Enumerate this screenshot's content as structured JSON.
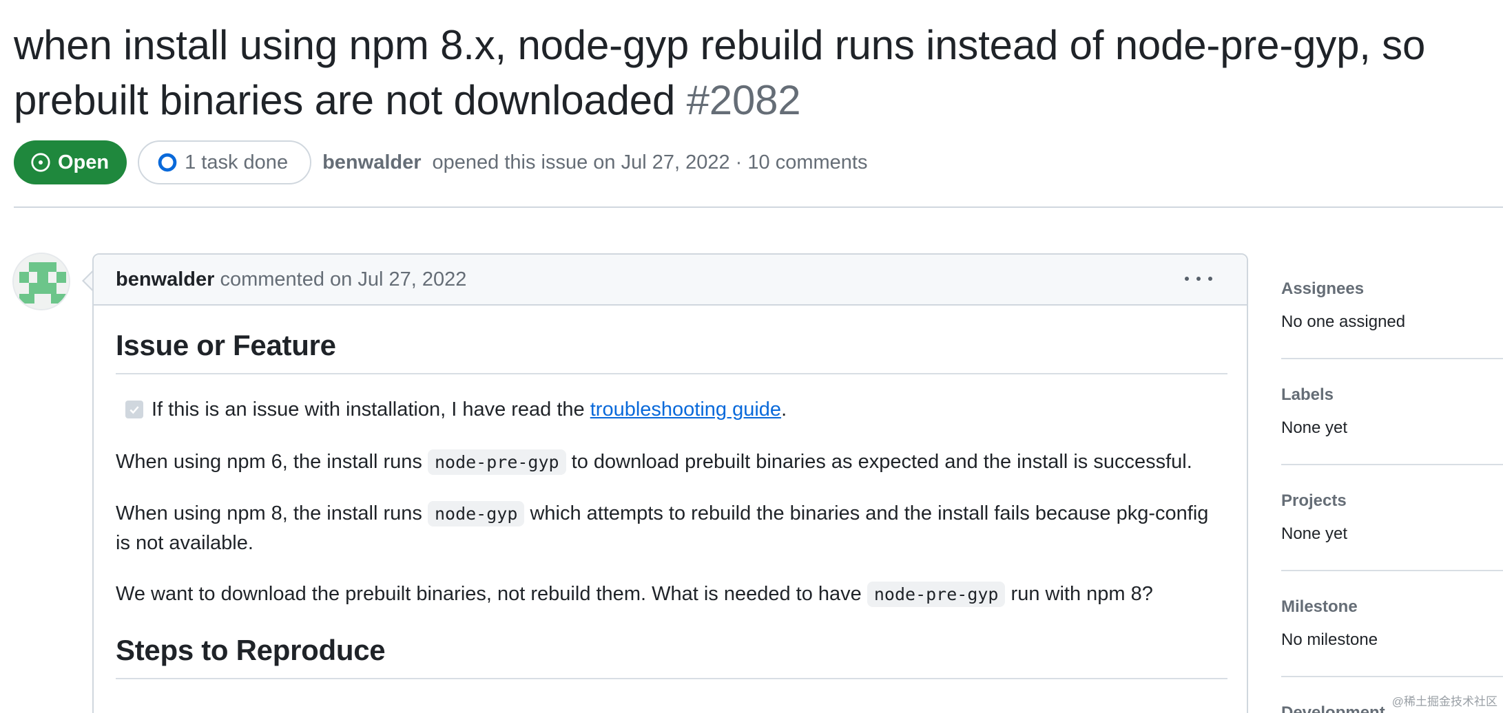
{
  "issue": {
    "title": "when install using npm 8.x, node-gyp rebuild runs instead of node-pre-gyp, so prebuilt binaries are not downloaded",
    "number": "#2082",
    "state": "Open",
    "tasks": "1 task done",
    "author": "benwalder",
    "opened_text": "opened this issue on Jul 27, 2022 · 10 comments"
  },
  "comment": {
    "author": "benwalder",
    "meta": "commented on Jul 27, 2022",
    "heading1": "Issue or Feature",
    "task_text_before": "If this is an issue with installation, I have read the",
    "task_link": "troubleshooting guide",
    "task_text_after": ".",
    "p1_a": "When using npm 6, the install runs",
    "p1_code": "node-pre-gyp",
    "p1_b": "to download prebuilt binaries as expected and the install is successful.",
    "p2_a": "When using npm 8, the install runs",
    "p2_code": "node-gyp",
    "p2_b": "which attempts to rebuild the binaries and the install fails because pkg-config is not available.",
    "p3_a": "We want to download the prebuilt binaries, not rebuild them. What is needed to have",
    "p3_code": "node-pre-gyp",
    "p3_b": "run with npm 8?",
    "heading2": "Steps to Reproduce"
  },
  "sidebar": {
    "assignees_label": "Assignees",
    "assignees_value": "No one assigned",
    "labels_label": "Labels",
    "labels_value": "None yet",
    "projects_label": "Projects",
    "projects_value": "None yet",
    "milestone_label": "Milestone",
    "milestone_value": "No milestone",
    "development_label": "Development"
  },
  "watermark": "@稀土掘金技术社区",
  "colors": {
    "open_green": "#1f883d",
    "link_blue": "#0969da",
    "muted": "#656d76",
    "border": "#d0d7de"
  }
}
